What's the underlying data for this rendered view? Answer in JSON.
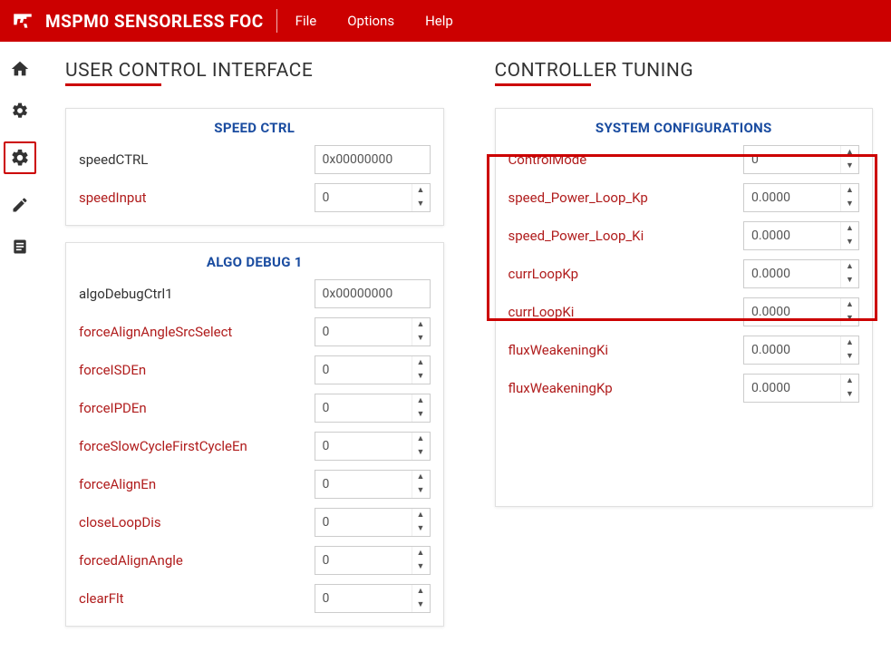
{
  "header": {
    "app_title": "MSPM0 SENSORLESS FOC",
    "menu": {
      "file": "File",
      "options": "Options",
      "help": "Help"
    }
  },
  "sections": {
    "left_title": "USER CONTROL INTERFACE",
    "right_title": "CONTROLLER TUNING"
  },
  "speed_ctrl": {
    "title": "SPEED CTRL",
    "rows": [
      {
        "label": "speedCTRL",
        "value": "0x00000000",
        "type": "text",
        "red": false
      },
      {
        "label": "speedInput",
        "value": "0",
        "type": "spin",
        "red": true
      }
    ]
  },
  "algo_debug": {
    "title": "ALGO DEBUG 1",
    "rows": [
      {
        "label": "algoDebugCtrl1",
        "value": "0x00000000",
        "type": "text",
        "red": false
      },
      {
        "label": "forceAlignAngleSrcSelect",
        "value": "0",
        "type": "spin",
        "red": true
      },
      {
        "label": "forceISDEn",
        "value": "0",
        "type": "spin",
        "red": true
      },
      {
        "label": "forceIPDEn",
        "value": "0",
        "type": "spin",
        "red": true
      },
      {
        "label": "forceSlowCycleFirstCycleEn",
        "value": "0",
        "type": "spin",
        "red": true
      },
      {
        "label": "forceAlignEn",
        "value": "0",
        "type": "spin",
        "red": true
      },
      {
        "label": "closeLoopDis",
        "value": "0",
        "type": "spin",
        "red": true
      },
      {
        "label": "forcedAlignAngle",
        "value": "0",
        "type": "spin",
        "red": true
      },
      {
        "label": "clearFlt",
        "value": "0",
        "type": "spin",
        "red": true
      }
    ]
  },
  "sys_config": {
    "title": "SYSTEM CONFIGURATIONS",
    "rows": [
      {
        "label": "ControlMode",
        "value": "0",
        "type": "spin",
        "red": true
      },
      {
        "label": "speed_Power_Loop_Kp",
        "value": "0.0000",
        "type": "spin",
        "red": true
      },
      {
        "label": "speed_Power_Loop_Ki",
        "value": "0.0000",
        "type": "spin",
        "red": true
      },
      {
        "label": "currLoopKp",
        "value": "0.0000",
        "type": "spin",
        "red": true
      },
      {
        "label": "currLoopKi",
        "value": "0.0000",
        "type": "spin",
        "red": true
      },
      {
        "label": "fluxWeakeningKi",
        "value": "0.0000",
        "type": "spin",
        "red": true
      },
      {
        "label": "fluxWeakeningKp",
        "value": "0.0000",
        "type": "spin",
        "red": true
      }
    ]
  }
}
